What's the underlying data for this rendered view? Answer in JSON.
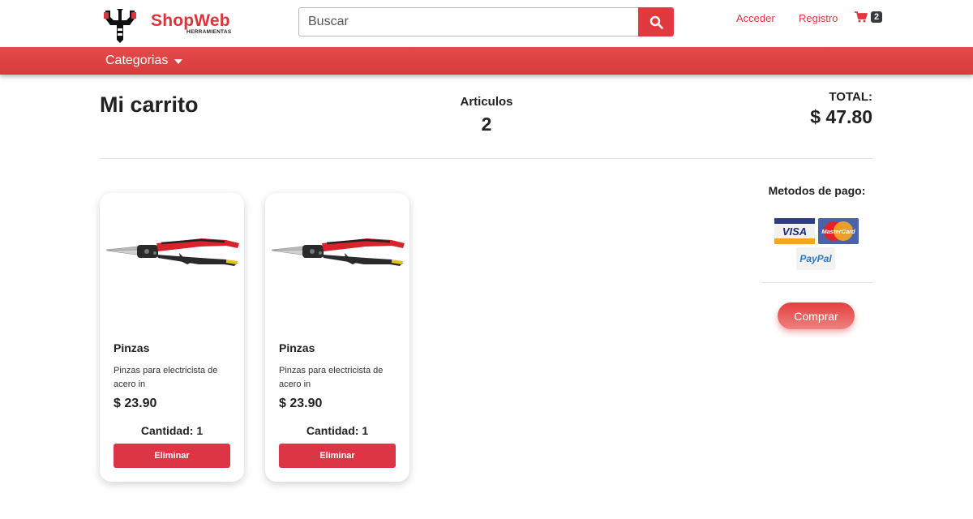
{
  "brand": {
    "name": "ShopWeb",
    "tagline": "HERRAMIENTAS",
    "accent": "#e0393e"
  },
  "search": {
    "placeholder": "Buscar",
    "value": "",
    "icon": "search-icon"
  },
  "header": {
    "login_label": "Acceder",
    "register_label": "Registro",
    "cart_count": "2",
    "cart_icon": "cart-icon"
  },
  "nav": {
    "categories_label": "Categorias"
  },
  "summary": {
    "title": "Mi carrito",
    "items_label": "Articulos",
    "items_count": "2",
    "total_label": "TOTAL:",
    "total_value": "$ 47.80"
  },
  "cart_items": [
    {
      "name": "Pinzas",
      "description": "Pinzas para electricista de acero in",
      "price": "$ 23.90",
      "quantity_label": "Cantidad: 1",
      "remove_label": "Eliminar"
    },
    {
      "name": "Pinzas",
      "description": "Pinzas para electricista de acero in",
      "price": "$ 23.90",
      "quantity_label": "Cantidad: 1",
      "remove_label": "Eliminar"
    }
  ],
  "payment": {
    "title": "Metodos de pago:",
    "visa_label": "VISA",
    "mastercard_label": "MasterCard",
    "paypal_label": "PayPal",
    "buy_label": "Comprar"
  }
}
